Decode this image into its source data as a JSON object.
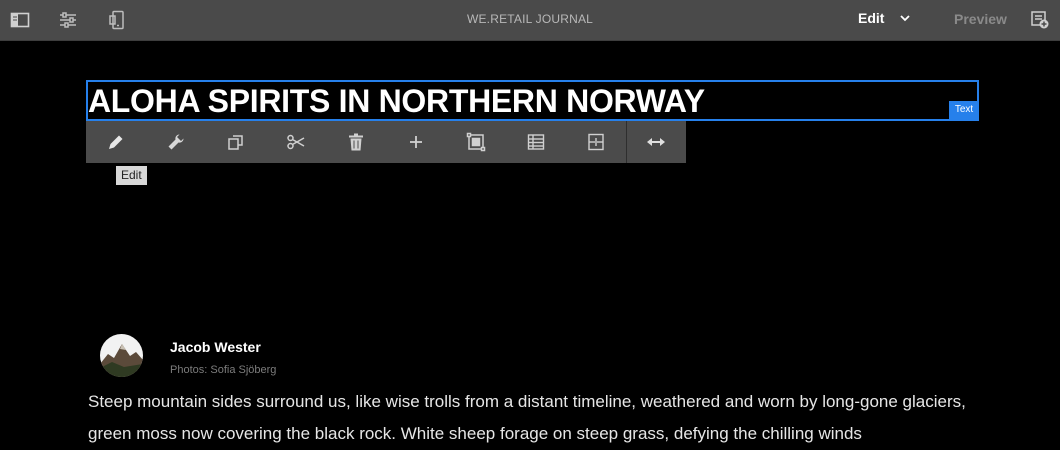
{
  "topbar": {
    "title": "WE.RETAIL JOURNAL",
    "mode_label": "Edit",
    "preview_label": "Preview",
    "icons": [
      "side-panel-icon",
      "page-properties-icon",
      "emulator-icon",
      "annotations-icon"
    ]
  },
  "editor": {
    "heading": "ALOHA SPIRITS IN NORTHERN NORWAY",
    "component_label": "Text",
    "tooltip": "Edit",
    "accent_color": "#2680eb",
    "toolbar_icons": [
      "pencil-icon",
      "wrench-icon",
      "copy-icon",
      "cut-icon",
      "delete-icon",
      "insert-icon",
      "group-icon",
      "parent-icon",
      "layout-icon",
      "resize-icon"
    ]
  },
  "article": {
    "author": "Jacob Wester",
    "photo_credit": "Photos: Sofia Sjöberg",
    "body": "Steep mountain sides surround us, like wise trolls from a distant timeline, weathered and worn by long-gone glaciers, green moss now covering the black rock. White sheep forage on steep grass, defying the chilling winds"
  }
}
